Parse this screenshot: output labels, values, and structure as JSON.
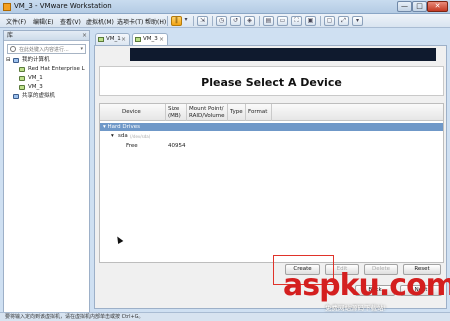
{
  "window": {
    "title": "VM_3 - VMware Workstation",
    "minimize": "—",
    "maximize": "□",
    "close": "✕"
  },
  "menu": [
    "文件(F)",
    "编辑(E)",
    "查看(V)",
    "虚拟机(M)",
    "选项卡(T)",
    "帮助(H)"
  ],
  "library": {
    "header": "库",
    "close": "×",
    "search_placeholder": "在此处键入内容进行...",
    "tree": {
      "root": "我的计算机",
      "vms": [
        "Red Hat Enterprise L",
        "VM_1",
        "VM_3"
      ],
      "shared": "共享的虚拟机"
    }
  },
  "tabs": [
    {
      "label": "VM_1",
      "close": "×",
      "active": false
    },
    {
      "label": "VM_3",
      "close": "×",
      "active": true
    }
  ],
  "guest": {
    "heading": "Please Select A Device",
    "columns": [
      [
        "Device"
      ],
      [
        "Size",
        "(MB)"
      ],
      [
        "Mount Point/",
        "RAID/Volume"
      ],
      [
        "Type"
      ],
      [
        "Format"
      ]
    ],
    "group": "Hard Drives",
    "disk": "sda",
    "disk_path": "(/dev/sda)",
    "free_label": "Free",
    "free_size": "40954",
    "buttons": [
      "Create",
      "Edit",
      "Delete",
      "Reset"
    ],
    "nav_buttons": [
      "Back",
      "Next"
    ]
  },
  "statusbar": "要将输入定向到该虚拟机，请在虚拟机内部单击或按 Ctrl+G。",
  "watermark": {
    "main": "aspku.com",
    "sub": "免费网站源码下载站!"
  },
  "colors": {
    "group_row": "#6f98c8",
    "highlight": "#e0332a",
    "watermark": "#d41f1f"
  }
}
